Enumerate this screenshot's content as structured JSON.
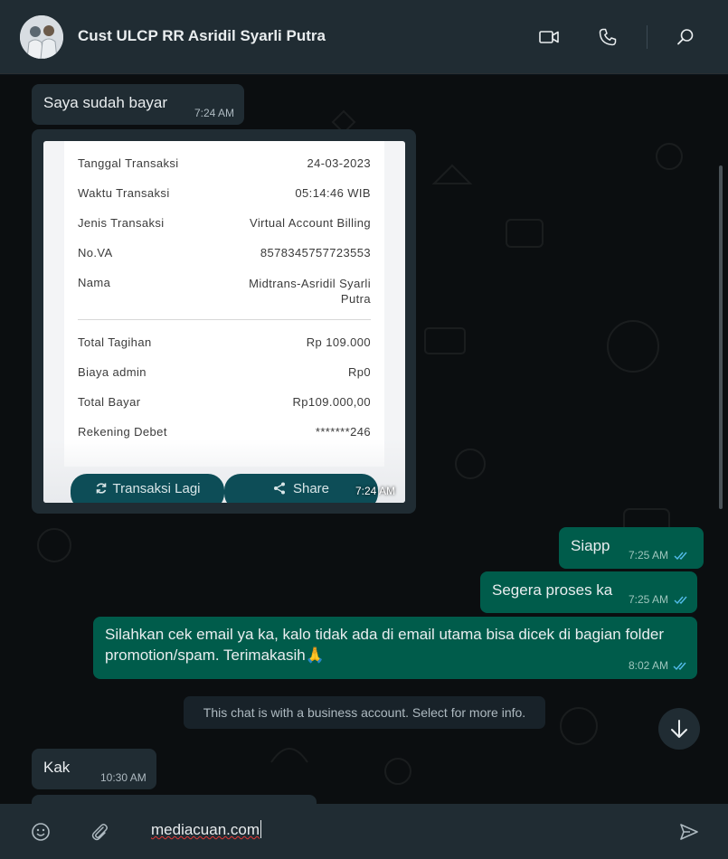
{
  "header": {
    "contact_name": "Cust ULCP RR Asridil Syarli Putra",
    "icons": [
      "video-call-icon",
      "voice-call-icon",
      "search-icon"
    ]
  },
  "messages": [
    {
      "direction": "incoming",
      "text": "Saya sudah bayar",
      "time": "7:24 AM"
    },
    {
      "direction": "incoming",
      "type": "image",
      "time": "7:24 AM"
    },
    {
      "direction": "outgoing",
      "text": "Siapp",
      "time": "7:25 AM",
      "status": "read"
    },
    {
      "direction": "outgoing",
      "text": "Segera proses ka",
      "time": "7:25 AM",
      "status": "read"
    },
    {
      "direction": "outgoing",
      "text": "Silahkan cek email ya ka, kalo tidak ada di email utama bisa dicek di bagian folder promotion/spam. Terimakasih🙏",
      "time": "8:02 AM",
      "status": "read"
    },
    {
      "direction": "incoming",
      "text": "Kak",
      "time": "10:30 AM"
    }
  ],
  "receipt": {
    "rows": [
      {
        "label": "Tanggal Transaksi",
        "value": "24-03-2023"
      },
      {
        "label": "Waktu Transaksi",
        "value": "05:14:46 WIB"
      },
      {
        "label": "Jenis Transaksi",
        "value": "Virtual Account Billing"
      },
      {
        "label": "No.VA",
        "value": "8578345757723553"
      },
      {
        "label": "Nama",
        "value": "Midtrans-Asridil Syarli Putra"
      },
      {
        "label": "Total Tagihan",
        "value": "Rp 109.000"
      },
      {
        "label": "Biaya admin",
        "value": "Rp0"
      },
      {
        "label": "Total Bayar",
        "value": "Rp109.000,00"
      },
      {
        "label": "Rekening Debet",
        "value": "*******246"
      }
    ],
    "buttons": {
      "again": "Transaksi Lagi",
      "share": "Share"
    }
  },
  "system_note": "This chat is with a business account. Select for more info.",
  "composer": {
    "value": "mediacuan.com"
  },
  "colors": {
    "header_bg": "#202c33",
    "incoming_bubble": "#202c33",
    "outgoing_bubble": "#005c4b",
    "read_tick": "#53bdeb"
  }
}
